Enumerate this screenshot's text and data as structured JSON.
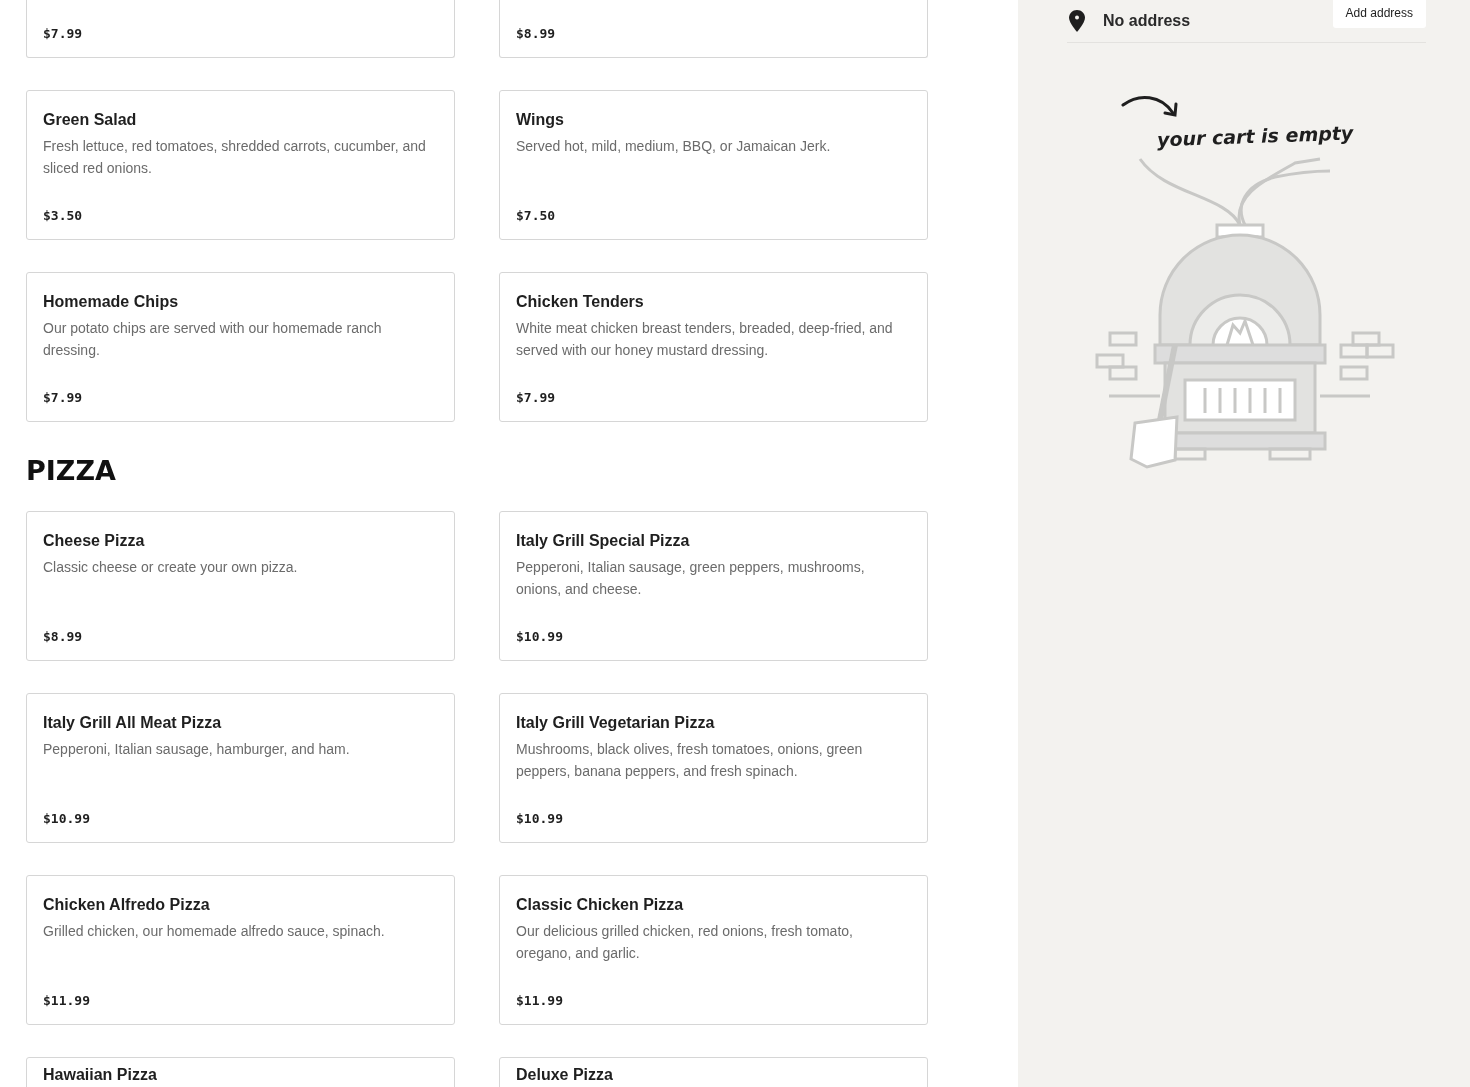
{
  "menu_sections": [
    {
      "items": [
        {
          "price": "$7.99"
        },
        {
          "price": "$8.99"
        },
        {
          "name": "Green Salad",
          "description": "Fresh lettuce, red tomatoes, shredded carrots, cucumber, and sliced red onions.",
          "price": "$3.50"
        },
        {
          "name": "Wings",
          "description": "Served hot, mild, medium, BBQ, or Jamaican Jerk.",
          "price": "$7.50"
        },
        {
          "name": "Homemade Chips",
          "description": "Our potato chips are served with our homemade ranch dressing.",
          "price": "$7.99"
        },
        {
          "name": "Chicken Tenders",
          "description": "White meat chicken breast tenders, breaded, deep-fried, and served with our honey mustard dressing.",
          "price": "$7.99"
        }
      ]
    },
    {
      "heading": "PIZZA",
      "items": [
        {
          "name": "Cheese Pizza",
          "description": "Classic cheese or create your own pizza.",
          "price": "$8.99"
        },
        {
          "name": "Italy Grill Special Pizza",
          "description": "Pepperoni, Italian sausage, green peppers, mushrooms, onions, and cheese.",
          "price": "$10.99"
        },
        {
          "name": "Italy Grill All Meat Pizza",
          "description": "Pepperoni, Italian sausage, hamburger, and ham.",
          "price": "$10.99"
        },
        {
          "name": "Italy Grill Vegetarian Pizza",
          "description": "Mushrooms, black olives, fresh tomatoes, onions, green peppers, banana peppers, and fresh spinach.",
          "price": "$10.99"
        },
        {
          "name": "Chicken Alfredo Pizza",
          "description": "Grilled chicken, our homemade alfredo sauce, spinach.",
          "price": "$11.99"
        },
        {
          "name": "Classic Chicken Pizza",
          "description": "Our delicious grilled chicken, red onions, fresh tomato, oregano, and garlic.",
          "price": "$11.99"
        },
        {
          "name": "Hawaiian Pizza"
        },
        {
          "name": "Deluxe Pizza"
        }
      ]
    }
  ],
  "cart": {
    "address": "No address",
    "add_address_button": "Add address",
    "empty_message": "your cart is empty"
  }
}
